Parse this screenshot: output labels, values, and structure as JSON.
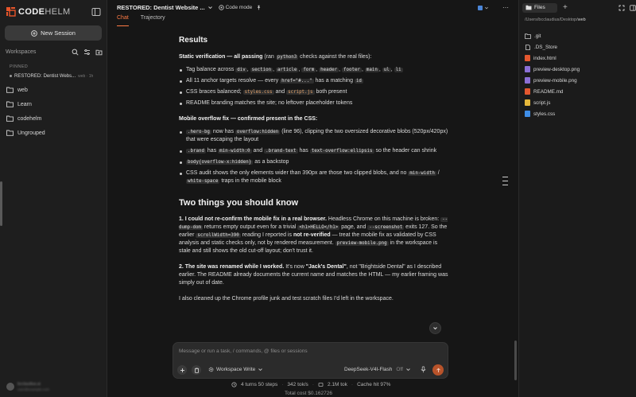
{
  "app": {
    "brand_bold": "CODE",
    "brand_light": "HELM"
  },
  "sidebar": {
    "new_session": "New Session",
    "workspaces_label": "Workspaces",
    "pinned_label": "PINNED",
    "pinned_item": {
      "title": "RESTORED: Dentist Webs...",
      "meta": "web · 1h"
    },
    "folders": [
      "web",
      "Learn",
      "codehelm",
      "Ungrouped"
    ],
    "user": {
      "name": "bcclaudius.ai",
      "email": "user@example.com"
    }
  },
  "topbar": {
    "title": "RESTORED: Dentist Website ...",
    "mode": "Code mode",
    "more": "⋯"
  },
  "tabs": [
    "Chat",
    "Trajectory"
  ],
  "content": {
    "results_heading": "Results",
    "static_label": "Static verification — all passing",
    "static_pre": "(ran",
    "static_code": "python3",
    "static_post": "checks against the real files):",
    "b1_text": "Tag balance across",
    "b1_tags": [
      "div",
      "section",
      "article",
      "form",
      "header",
      "footer",
      "main",
      "ul",
      "li"
    ],
    "b2_pre": "All 11 anchor targets resolve — every",
    "b2_code1": "href=\"#...\"",
    "b2_mid": "has a matching",
    "b2_code2": "id",
    "b3_pre": "CSS braces balanced;",
    "b3_file1": "styles.css",
    "b3_mid": "and",
    "b3_file2": "script.js",
    "b3_post": "both present",
    "b4": "README branding matches the site; no leftover placeholder tokens",
    "mobile_label": "Mobile overflow fix — confirmed present in the CSS:",
    "m1_code1": ".hero-bg",
    "m1_mid": "now has",
    "m1_code2": "overflow:hidden",
    "m1_post": "(line 96), clipping the two oversized decorative blobs (520px/420px) that were escaping the layout",
    "m2_code1": ".brand",
    "m2_mid1": "has",
    "m2_code2": "min-width:0",
    "m2_mid2": "and",
    "m2_code3": ".brand-text",
    "m2_mid3": "has",
    "m2_code4": "text-overflow:ellipsis",
    "m2_post": "so the header can shrink",
    "m3_code": "body{overflow-x:hidden}",
    "m3_post": "as a backstop",
    "m4_pre": "CSS audit shows the only elements wider than 390px are those two clipped blobs, and no",
    "m4_code1": "min-width",
    "m4_mid": "/",
    "m4_code2": "white-space",
    "m4_post": "traps in the mobile block",
    "two_heading": "Two things you should know",
    "p1_bold": "1. I could not re-confirm the mobile fix in a real browser.",
    "p1_a": "Headless Chrome on this machine is broken:",
    "p1_code1": "--dump-dom",
    "p1_b": "returns empty output even for a trivial",
    "p1_code2": "<h1>HELLO</h1>",
    "p1_c": "page, and",
    "p1_code3": "--screenshot",
    "p1_d": "exits 127. So the earlier",
    "p1_code4": "scrollWidth=390",
    "p1_e": "reading I reported is",
    "p1_bold2": "not re-verified",
    "p1_f": "— treat the mobile fix as validated by CSS analysis and static checks only, not by rendered measurement.",
    "p1_code5": "preview-mobile.png",
    "p1_g": "in the workspace is stale and still shows the old cut-off layout; don't trust it.",
    "p2_bold": "2. The site was renamed while I worked.",
    "p2_a": "It's now",
    "p2_bold2": "\"Jack's Dental\"",
    "p2_b": ", not \"Brightside Dental\" as I described earlier. The README already documents the current name and matches the HTML — my earlier framing was simply out of date.",
    "p3": "I also cleaned up the Chrome profile junk and test scratch files I'd left in the workspace."
  },
  "composer": {
    "placeholder": "Message or run a task, / commands, @ files or sessions",
    "workspace_mode": "Workspace Write",
    "model": "DeepSeek-V4I-Flash",
    "model_state": "Off"
  },
  "stats": {
    "turns": "4 turns 50 steps",
    "speed": "342 tok/s",
    "tokens": "2.1M tok",
    "cache": "Cache hit 97%",
    "cost": "Total cost $0.162726"
  },
  "files_panel": {
    "tab": "Files",
    "path_prefix": "/Users/bcclaudius/Desktop/",
    "path_current": "web",
    "entries": [
      {
        "name": ".git",
        "kind": "folder"
      },
      {
        "name": ".DS_Store",
        "kind": "file"
      },
      {
        "name": "index.html",
        "kind": "html"
      },
      {
        "name": "preview-desktop.png",
        "kind": "image"
      },
      {
        "name": "preview-mobile.png",
        "kind": "image"
      },
      {
        "name": "README.md",
        "kind": "markdown"
      },
      {
        "name": "script.js",
        "kind": "js"
      },
      {
        "name": "styles.css",
        "kind": "css"
      }
    ]
  },
  "colors": {
    "accent": "#ff7b45",
    "send_button": "#b8532a",
    "html_icon": "#e3572f",
    "image_icon": "#8b6fd6",
    "markdown_icon": "#e3572f",
    "js_icon": "#e6b83b",
    "css_icon": "#3f8ee8",
    "folder_icon": "#cfcfcf"
  }
}
